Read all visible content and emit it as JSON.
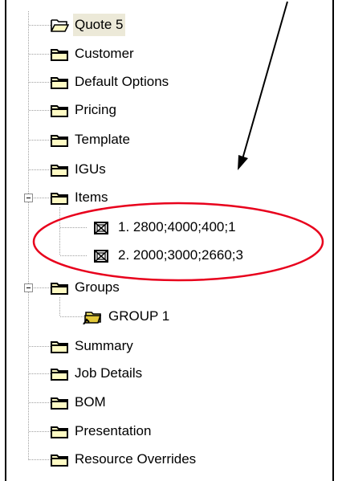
{
  "tree": {
    "root": {
      "label": "Quote 5",
      "icon": "folder-open-icon"
    },
    "nodes": [
      {
        "key": "customer",
        "label": "Customer",
        "icon": "folder-icon"
      },
      {
        "key": "default-options",
        "label": "Default Options",
        "icon": "folder-icon"
      },
      {
        "key": "pricing",
        "label": "Pricing",
        "icon": "folder-icon"
      },
      {
        "key": "template",
        "label": "Template",
        "icon": "folder-icon"
      },
      {
        "key": "igus",
        "label": "IGUs",
        "icon": "folder-icon"
      },
      {
        "key": "items",
        "label": "Items",
        "icon": "folder-icon",
        "expanded": true,
        "children": [
          {
            "label": "1. 2800;4000;400;1",
            "icon": "item-icon"
          },
          {
            "label": "2. 2000;3000;2660;3",
            "icon": "item-icon"
          }
        ]
      },
      {
        "key": "groups",
        "label": "Groups",
        "icon": "folder-icon",
        "expanded": true,
        "children": [
          {
            "label": "GROUP 1",
            "icon": "group-folder-icon"
          }
        ]
      },
      {
        "key": "summary",
        "label": "Summary",
        "icon": "folder-icon"
      },
      {
        "key": "job-details",
        "label": "Job Details",
        "icon": "folder-icon"
      },
      {
        "key": "bom",
        "label": "BOM",
        "icon": "folder-icon"
      },
      {
        "key": "presentation",
        "label": "Presentation",
        "icon": "folder-icon"
      },
      {
        "key": "resource-overrides",
        "label": "Resource Overrides",
        "icon": "folder-icon"
      }
    ]
  },
  "annotation": {
    "highlight_color": "#e8001c",
    "arrow_color": "#000000"
  },
  "colors": {
    "folder_fill": "#fffbc4",
    "folder_stroke": "#000000",
    "dotted_line": "#a0a0a0",
    "selection_bg": "#ece9d8"
  }
}
